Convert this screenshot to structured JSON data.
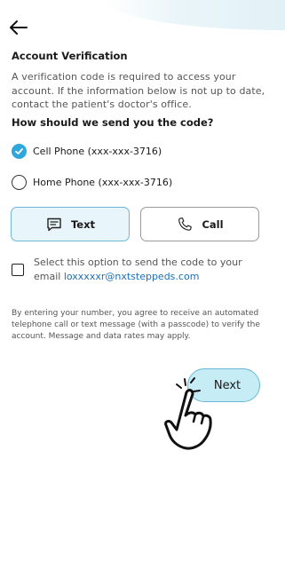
{
  "header": {
    "back_icon": "arrow-left-icon"
  },
  "verification": {
    "title": "Account Verification",
    "description": "A verification code is required to access your account. If the information below is not up to date, contact the patient's doctor's office."
  },
  "send_code": {
    "question": "How should we send you the code?",
    "options": [
      {
        "label": "Cell Phone (xxx-xxx-3716)",
        "selected": true
      },
      {
        "label": "Home Phone (xxx-xxx-3716)",
        "selected": false
      }
    ]
  },
  "methods": {
    "text_label": "Text",
    "text_icon": "message-icon",
    "call_label": "Call",
    "call_icon": "phone-icon",
    "selected": "Text"
  },
  "email_option": {
    "text": "Select this option to send the code to your email ",
    "email": "loxxxxxr@nxtsteppeds.com",
    "checked": false
  },
  "consent": {
    "text": "By entering your number, you agree to receive an automated telephone call or text message (with a passcode) to verify the account. Message and data rates may apply."
  },
  "actions": {
    "next_label": "Next"
  },
  "colors": {
    "accent": "#2fa7dc",
    "selected_bg": "#e8f5fa",
    "next_bg": "#c6ecf5",
    "link": "#1f6fb5"
  }
}
